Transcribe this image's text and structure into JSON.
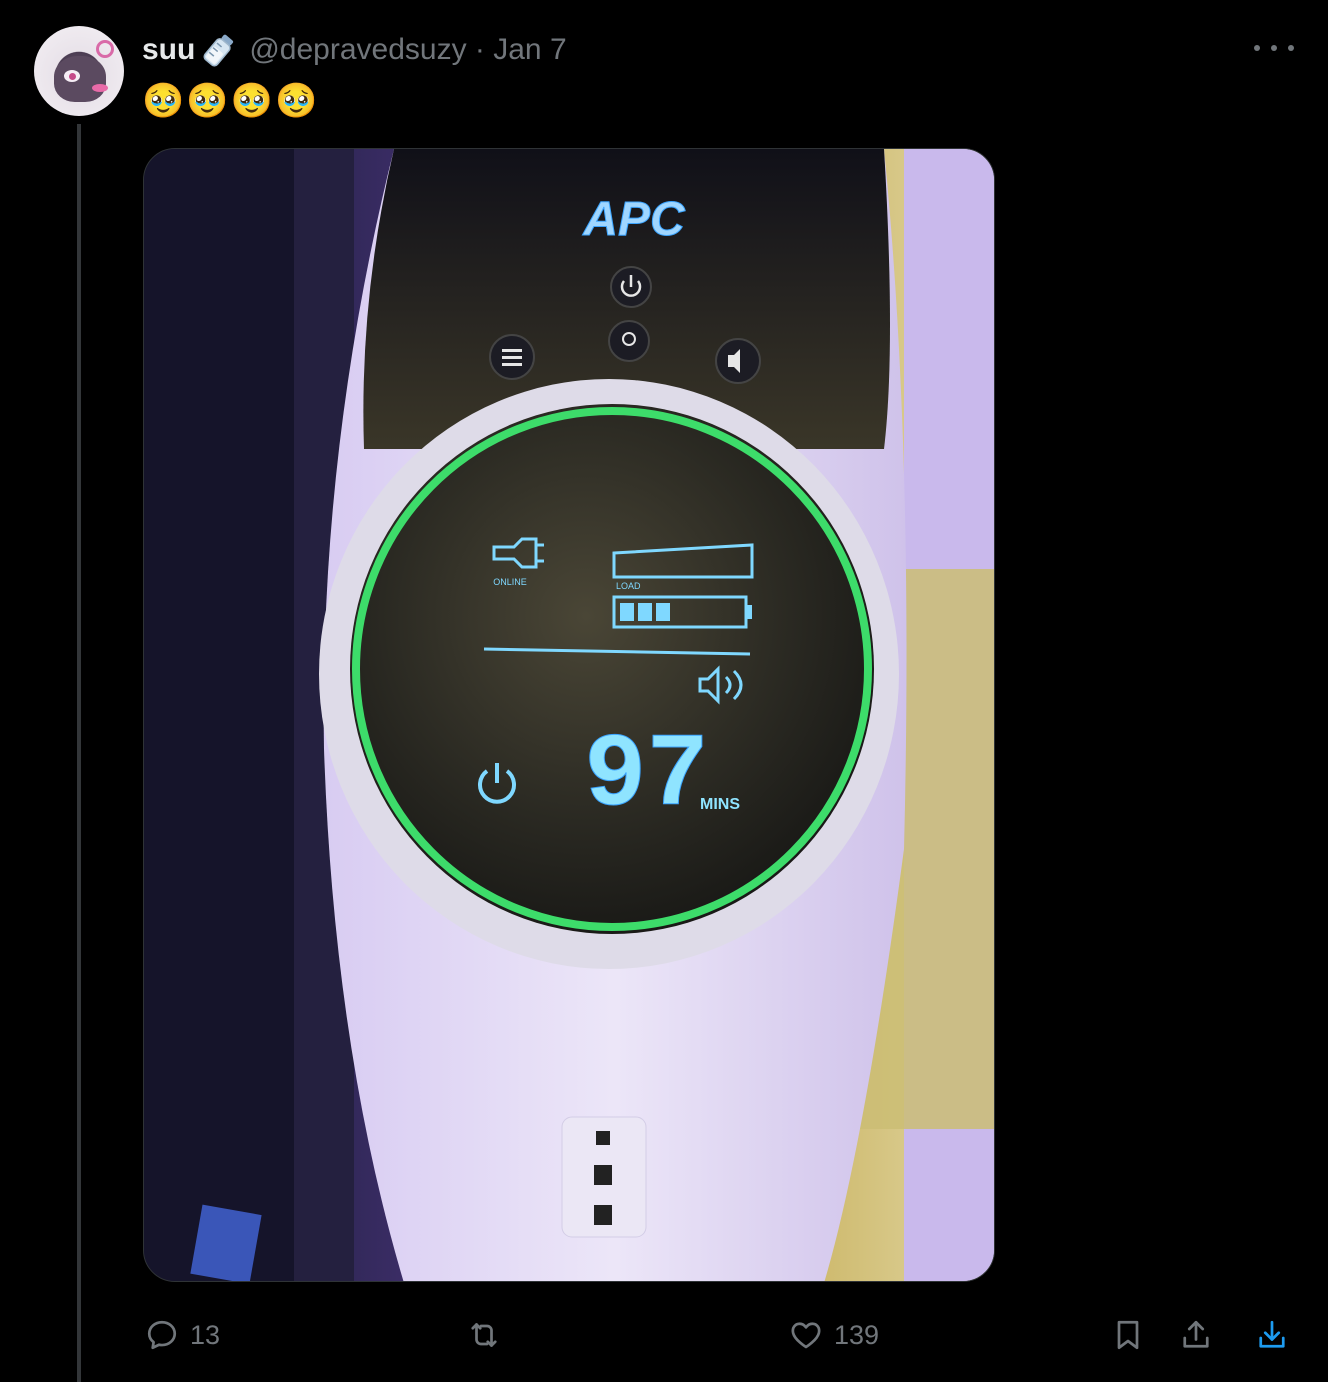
{
  "post": {
    "display_name": "suu",
    "name_emoji_icon": "baby-bottle-icon",
    "handle_and_date": "@depravedsuzy · Jan 7",
    "text": "🥹🥹🥹🥹"
  },
  "media": {
    "device_brand": "APC",
    "lcd_minutes": "97",
    "lcd_unit": "MINS",
    "lcd_load_label": "LOAD",
    "lcd_online_label": "ONLINE",
    "ring_color": "#3ddc6a",
    "lcd_color": "#7fd8ff"
  },
  "actions": {
    "replies": "13",
    "likes": "139",
    "accent_color": "#1d9bf0"
  }
}
